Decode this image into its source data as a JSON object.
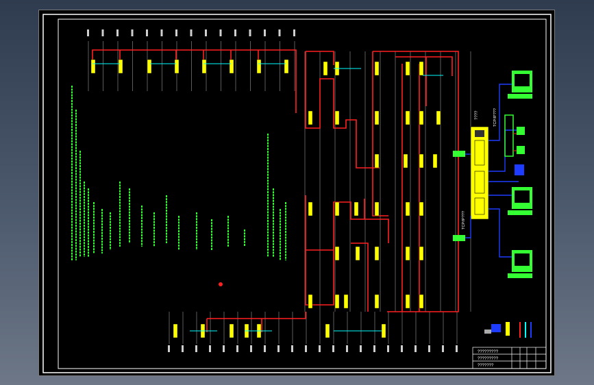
{
  "drawing": {
    "title_block": {
      "row1": "?????????",
      "row2": "?????????",
      "row3": "???????"
    },
    "controller_label": "????",
    "network_labels": {
      "top": "TCP/IP???",
      "bottom": "TCP/IP???"
    },
    "legend": {
      "items": [
        "??????",
        "????",
        "????",
        "????"
      ],
      "colors": [
        "#ffff00",
        "#ff2020",
        "#00ffff",
        "#1e3cff"
      ]
    },
    "colors": {
      "frame": "#ffffff",
      "bus": "#ff2020",
      "device": "#ffff00",
      "link": "#00ffff",
      "network": "#1e3cff",
      "text": "#33ff33"
    }
  }
}
